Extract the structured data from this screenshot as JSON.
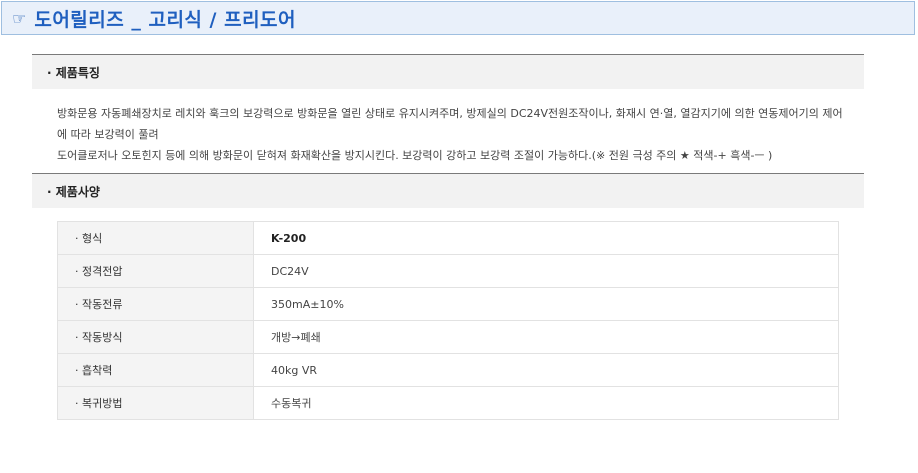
{
  "header": {
    "icon": "pointing-hand-icon",
    "icon_glyph": "☞",
    "title": "도어릴리즈 _ 고리식 / 프리도어"
  },
  "features": {
    "heading": "· 제품특징",
    "line1": "방화문용 자동폐쇄장치로 레치와 훅크의 보강력으로 방화문을 열린 상태로 유지시켜주며, 방제실의 DC24V전원조작이나, 화재시 연·열, 열감지기에 의한 연동제어기의 제어에 따라 보강력이 풀려",
    "line2": "도어클로저나 오토힌지 등에 의해 방화문이 닫혀져 화재확산을 방지시킨다. 보강력이 강하고 보강력 조절이 가능하다.(※ 전원 극성 주의 ★ 적색-+ 흑색-ㅡ )"
  },
  "specs": {
    "heading": "· 제품사양",
    "rows": [
      {
        "key": "· 형식",
        "value": "K-200"
      },
      {
        "key": "· 정격전압",
        "value": "DC24V"
      },
      {
        "key": "· 작동전류",
        "value": "350mA±10%"
      },
      {
        "key": "· 작동방식",
        "value": "개방→폐쇄"
      },
      {
        "key": "· 흡착력",
        "value": "40kg VR"
      },
      {
        "key": "· 복귀방법",
        "value": "수동복귀"
      }
    ]
  }
}
